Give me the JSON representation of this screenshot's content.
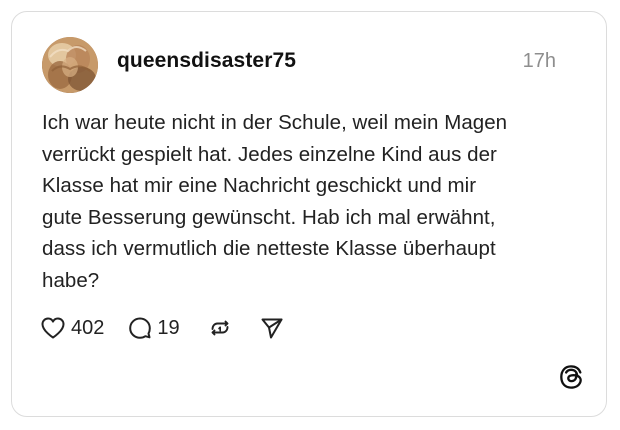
{
  "post": {
    "username": "queensdisaster75",
    "timestamp": "17h",
    "lines": [
      "Ich war heute nicht in der Schule, weil mein Magen",
      "verrückt gespielt hat. Jedes einzelne Kind aus der",
      "Klasse hat mir eine Nachricht geschickt und mir",
      "gute Besserung gewünscht. Hab ich mal erwähnt,",
      "dass ich vermutlich die netteste Klasse überhaupt",
      "habe?"
    ],
    "likes": "402",
    "replies": "19"
  },
  "icons": {
    "like": "heart-icon",
    "reply": "comment-bubble-icon",
    "repost": "repost-icon",
    "share": "send-icon",
    "brand": "threads-logo-icon"
  },
  "colors": {
    "text": "#222222",
    "muted": "#8e8e8e",
    "border": "#dcdcdc"
  }
}
